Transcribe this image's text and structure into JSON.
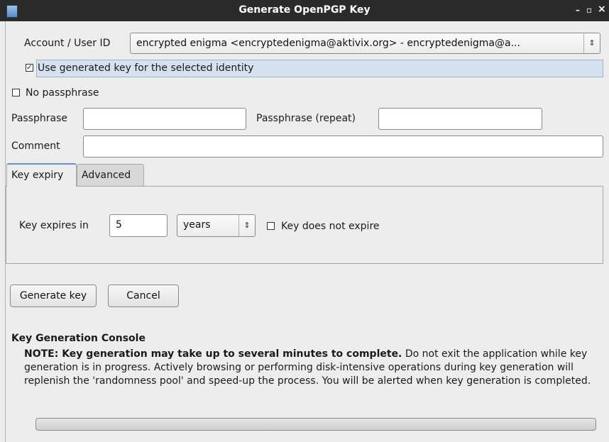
{
  "window": {
    "title": "Generate OpenPGP Key",
    "minimize": "–",
    "maximize": "▫",
    "close": "×"
  },
  "account": {
    "label": "Account / User ID",
    "value": "encrypted enigma <encryptedenigma@aktivix.org> - encryptedenigma@a...",
    "spin_icon": "⇕"
  },
  "use_generated_key": {
    "label": "Use generated key for the selected identity",
    "checked": true
  },
  "no_passphrase": {
    "label": "No passphrase",
    "checked": false
  },
  "passphrase": {
    "label": "Passphrase",
    "value": ""
  },
  "passphrase_repeat": {
    "label": "Passphrase (repeat)",
    "value": ""
  },
  "comment": {
    "label": "Comment",
    "value": ""
  },
  "tabs": [
    {
      "label": "Key expiry",
      "active": true
    },
    {
      "label": "Advanced",
      "active": false
    }
  ],
  "expiry": {
    "label": "Key expires in",
    "value": "5",
    "unit": "years",
    "does_not_expire_label": "Key does not expire",
    "does_not_expire_checked": false
  },
  "buttons": {
    "generate": "Generate key",
    "cancel": "Cancel"
  },
  "console": {
    "title": "Key Generation Console",
    "note_bold": "NOTE: Key generation may take up to several minutes to complete.",
    "note_text": " Do not exit the application while key generation is in progress. Actively browsing or performing disk-intensive operations during key generation will replenish the 'randomness pool' and speed-up the process. You will be alerted when key generation is completed.",
    "progress": 0
  },
  "colors": {
    "titlebar": "#2b2b2b",
    "tab_accent": "#6a8fc0",
    "highlight_row": "#d5e1ee"
  }
}
